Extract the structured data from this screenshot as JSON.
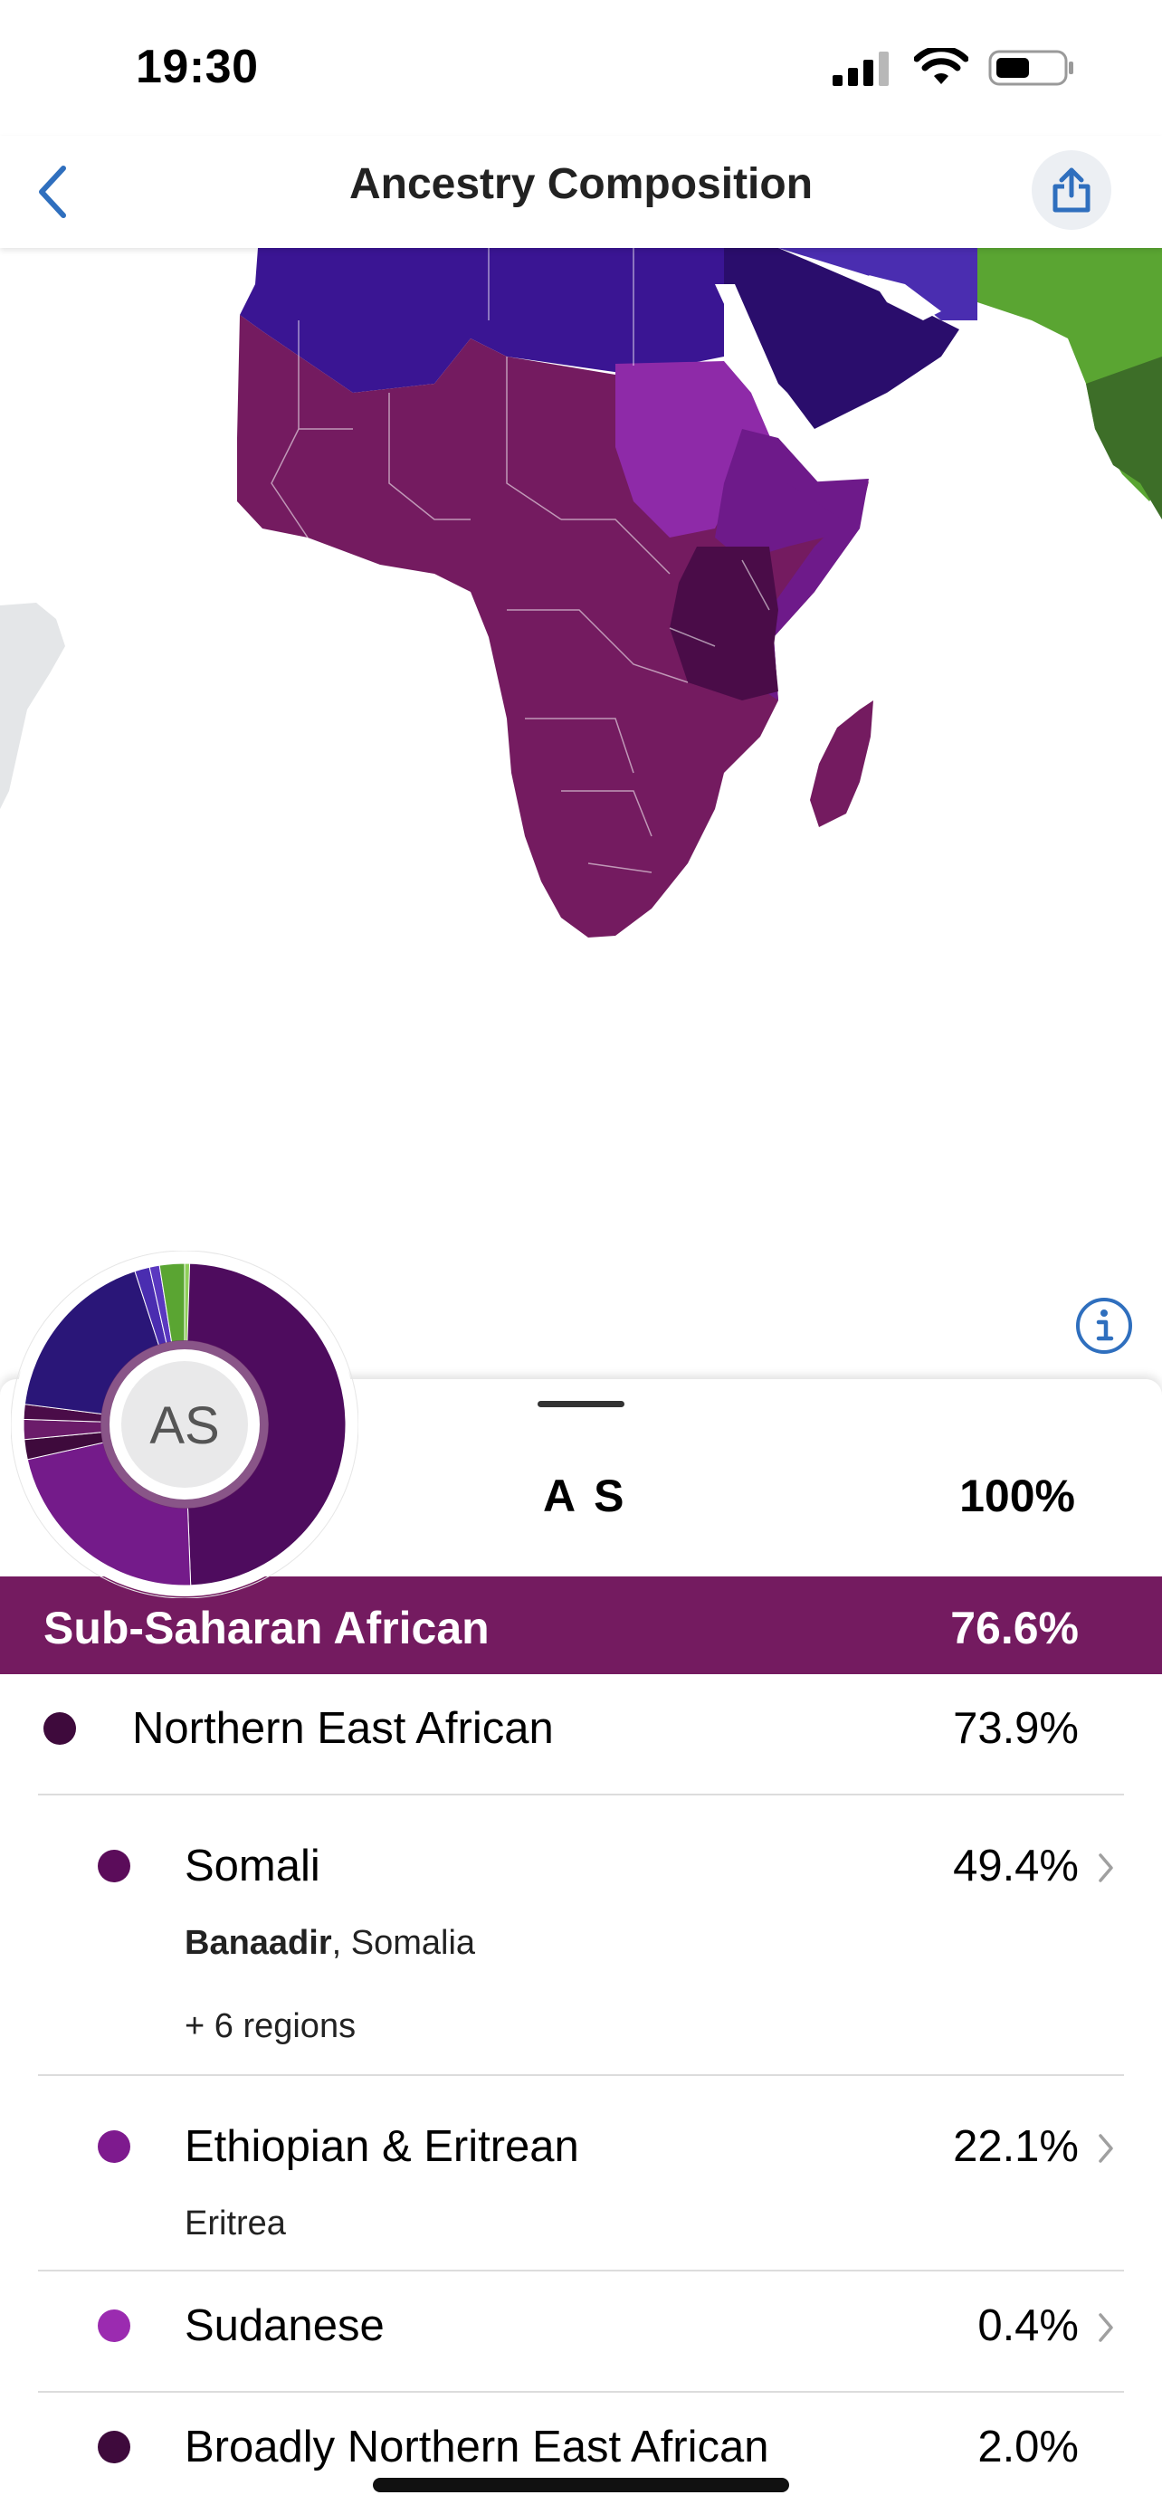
{
  "status_bar": {
    "time": "19:30"
  },
  "nav": {
    "title": "Ancestry Composition",
    "back_icon": "chevron-left-icon",
    "share_icon": "share-icon"
  },
  "map": {
    "info_icon": "info-icon",
    "colors": {
      "north_africa": "#3a1593",
      "arabia": "#2a0d6c",
      "sub_saharan": "#741b60",
      "sudan": "#8e2aa8",
      "ethiopia": "#6e1a8a",
      "east_africa": "#4a0c48",
      "south_asia": "#5aa532",
      "south_asia_dark": "#3d6e28"
    }
  },
  "donut": {
    "initials": "AS"
  },
  "summary": {
    "name": "A S",
    "percent": "100%"
  },
  "category": {
    "name": "Sub-Saharan African",
    "percent": "76.6%",
    "color": "#741b60"
  },
  "rows": [
    {
      "name": "Northern East African",
      "percent": "73.9%",
      "color": "#3e0a3c"
    },
    {
      "name": "Somali",
      "percent": "49.4%",
      "color": "#5b0c5a",
      "sub_bold": "Banaadir",
      "sub_rest": ", Somalia",
      "sub2": "+ 6 regions"
    },
    {
      "name": "Ethiopian & Eritrean",
      "percent": "22.1%",
      "color": "#7e1a8e",
      "sub": "Eritrea"
    },
    {
      "name": "Sudanese",
      "percent": "0.4%",
      "color": "#9b2bb0"
    },
    {
      "name": "Broadly Northern East African",
      "percent": "2.0%",
      "color": "#3e0a3c"
    }
  ]
}
